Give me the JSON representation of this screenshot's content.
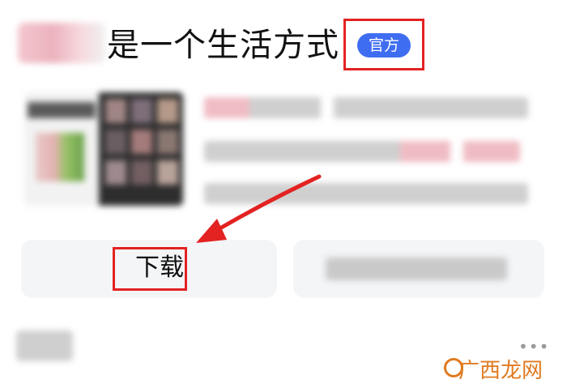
{
  "header": {
    "title": "是一个生活方式",
    "badge": "官方"
  },
  "actions": {
    "download_label": "下载"
  },
  "footer": {
    "more": "•••"
  },
  "watermark": {
    "text": "广西龙网"
  },
  "colors": {
    "badge_bg": "#3f6df2",
    "annotation_red": "#e32222",
    "watermark_orange": "#e07a20"
  }
}
